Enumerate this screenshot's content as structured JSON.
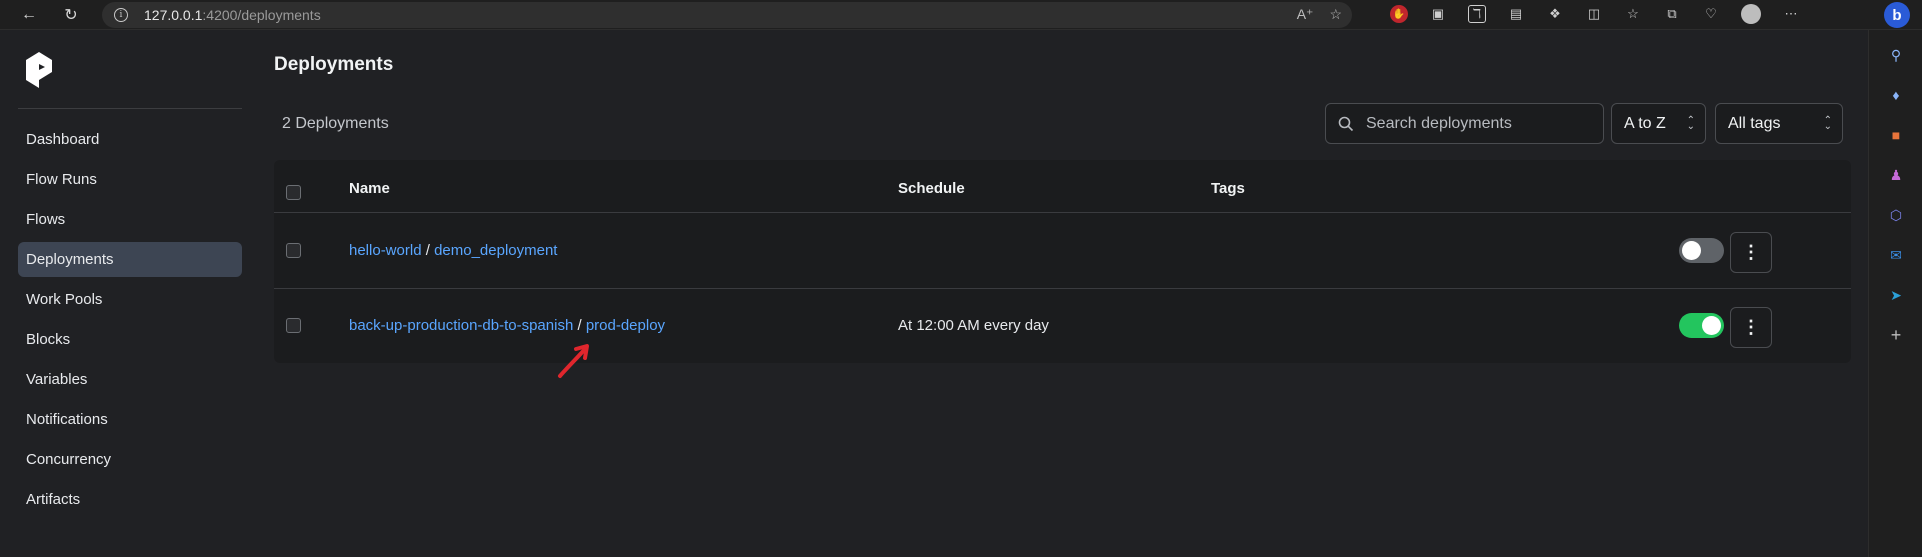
{
  "browser": {
    "url_host": "127.0.0.1",
    "url_path": ":4200/deployments"
  },
  "sidebar": {
    "items": [
      {
        "label": "Dashboard"
      },
      {
        "label": "Flow Runs"
      },
      {
        "label": "Flows"
      },
      {
        "label": "Deployments",
        "active": true
      },
      {
        "label": "Work Pools"
      },
      {
        "label": "Blocks"
      },
      {
        "label": "Variables"
      },
      {
        "label": "Notifications"
      },
      {
        "label": "Concurrency"
      },
      {
        "label": "Artifacts"
      }
    ]
  },
  "main": {
    "title": "Deployments",
    "count": "2 Deployments",
    "search_placeholder": "Search deployments",
    "sort_value": "A to Z",
    "tags_value": "All tags",
    "columns": {
      "name": "Name",
      "schedule": "Schedule",
      "tags": "Tags"
    },
    "rows": [
      {
        "flow": "hello-world",
        "sep": "/",
        "deployment": "demo_deployment",
        "schedule": "",
        "active": false
      },
      {
        "flow": "back-up-production-db-to-spanish",
        "sep": "/",
        "deployment": "prod-deploy",
        "schedule": "At 12:00 AM every day",
        "active": true
      }
    ]
  },
  "colors": {
    "link": "#5aa6ff",
    "toggle_on": "#23c55e",
    "toggle_off": "#5f6368",
    "active_nav": "#3d4553",
    "annotation_arrow": "#e0262d"
  }
}
